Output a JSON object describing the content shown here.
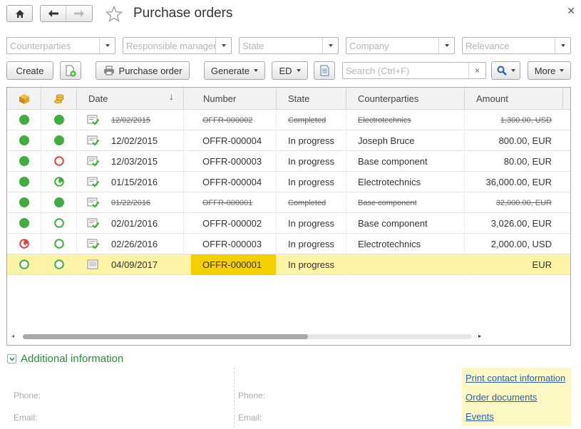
{
  "window": {
    "title": "Purchase orders"
  },
  "filters": [
    {
      "placeholder": "Counterparties"
    },
    {
      "placeholder": "Responsible manager"
    },
    {
      "placeholder": "State"
    },
    {
      "placeholder": "Company"
    },
    {
      "placeholder": "Relevance"
    }
  ],
  "toolbar": {
    "create_label": "Create",
    "purchase_order_label": "Purchase order",
    "generate_label": "Generate",
    "ed_label": "ED",
    "search_placeholder": "Search (Ctrl+F)",
    "search_clear": "×",
    "more_label": "More"
  },
  "table": {
    "columns": {
      "date": "Date",
      "number": "Number",
      "state": "State",
      "counterparties": "Counterparties",
      "amount": "Amount"
    },
    "rows": [
      {
        "date": "12/02/2015",
        "number": "OFFR-000002",
        "state": "Completed",
        "counterparty": "Electrotechnics",
        "amount": "1,300.00, USD",
        "completed": true,
        "selected": false,
        "s1": "green",
        "s2": "green",
        "doc": "approved"
      },
      {
        "date": "12/02/2015",
        "number": "OFFR-000004",
        "state": "In progress",
        "counterparty": "Joseph Bruce",
        "amount": "800.00, EUR",
        "completed": false,
        "selected": false,
        "s1": "green",
        "s2": "green",
        "doc": "approved"
      },
      {
        "date": "12/03/2015",
        "number": "OFFR-000003",
        "state": "In progress",
        "counterparty": "Base component",
        "amount": "80.00, EUR",
        "completed": false,
        "selected": false,
        "s1": "green",
        "s2": "red-ring",
        "doc": "approved"
      },
      {
        "date": "01/15/2016",
        "number": "OFFR-000004",
        "state": "In progress",
        "counterparty": "Electrotechnics",
        "amount": "36,000.00, EUR",
        "completed": false,
        "selected": false,
        "s1": "green",
        "s2": "green-clock",
        "doc": "approved"
      },
      {
        "date": "01/22/2016",
        "number": "OFFR-000001",
        "state": "Completed",
        "counterparty": "Base component",
        "amount": "32,000.00, EUR",
        "completed": true,
        "selected": false,
        "s1": "green",
        "s2": "green",
        "doc": "approved"
      },
      {
        "date": "02/01/2016",
        "number": "OFFR-000002",
        "state": "In progress",
        "counterparty": "Base component",
        "amount": "3,026.00, EUR",
        "completed": false,
        "selected": false,
        "s1": "green",
        "s2": "green-ring",
        "doc": "approved"
      },
      {
        "date": "02/26/2016",
        "number": "OFFR-000003",
        "state": "In progress",
        "counterparty": "Electrotechnics",
        "amount": "2,000.00, USD",
        "completed": false,
        "selected": false,
        "s1": "red-clock",
        "s2": "green-ring",
        "doc": "approved"
      },
      {
        "date": "04/09/2017",
        "number": "OFFR-000001",
        "state": "In progress",
        "counterparty": "",
        "amount": "EUR",
        "completed": false,
        "selected": true,
        "s1": "green-ring",
        "s2": "green-ring",
        "doc": "draft"
      }
    ]
  },
  "additional": {
    "label": "Additional information",
    "left": {
      "phone": "Phone:",
      "email": "Email:"
    },
    "right": {
      "phone": "Phone:",
      "email": "Email:"
    },
    "links": [
      "Print contact information",
      "Order documents",
      "Events"
    ]
  },
  "colors": {
    "green": "#3fae3f",
    "red": "#e0443a",
    "selection": "#fbf3a6",
    "number_highlight": "#f5d000",
    "link": "#2a5fb0",
    "section_green": "#2e8b3e"
  },
  "icons": {
    "home": "home-icon",
    "back": "arrow-left-icon",
    "forward": "arrow-right-icon",
    "favorite": "star-icon",
    "close": "close-icon",
    "print": "printer-icon",
    "search": "magnifier-icon"
  }
}
